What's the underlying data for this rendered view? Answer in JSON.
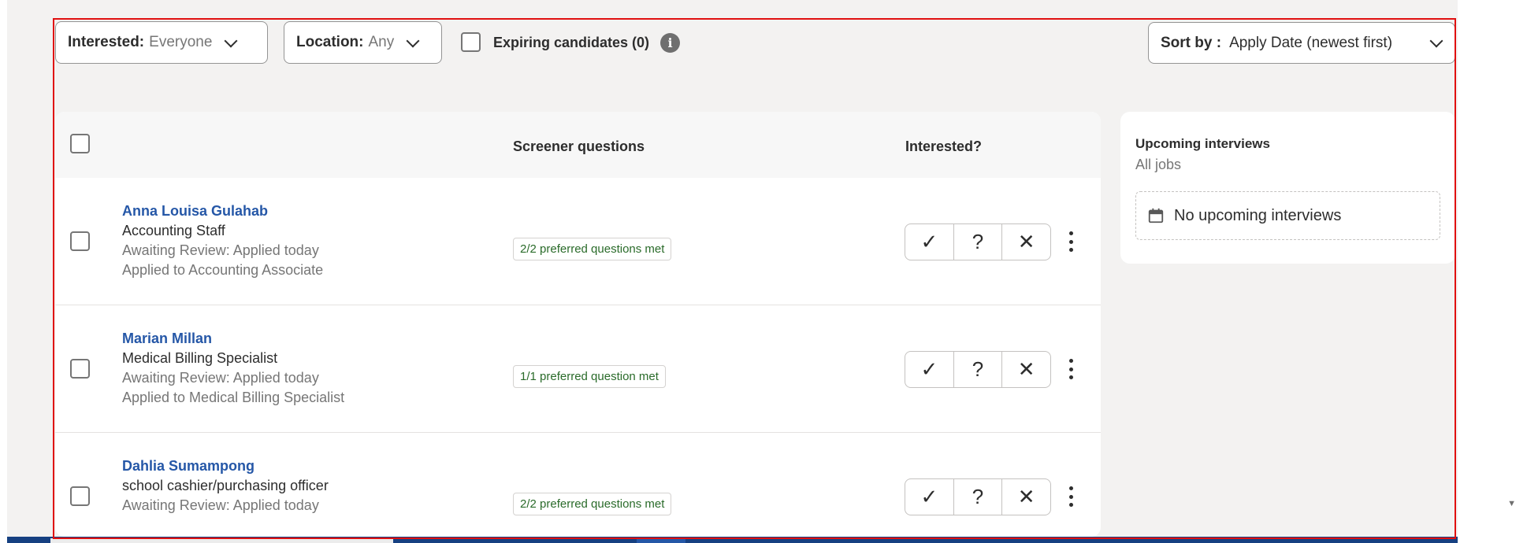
{
  "filters": {
    "interested_key": "Interested:",
    "interested_value": "Everyone",
    "location_key": "Location:",
    "location_value": "Any",
    "expiring_label": "Expiring candidates (0)",
    "info_icon": "i"
  },
  "sort": {
    "key": "Sort by :",
    "value": "Apply Date (newest first)"
  },
  "table": {
    "headers": {
      "screener": "Screener questions",
      "interested": "Interested?"
    },
    "action_icons": {
      "yes": "✓",
      "maybe": "?",
      "no": "✕"
    },
    "candidates": [
      {
        "name": "Anna Louisa Gulahab",
        "job": "Accounting Staff",
        "status": "Awaiting Review: Applied today",
        "applied_to": "Applied to Accounting Associate",
        "screener": "2/2 preferred questions met"
      },
      {
        "name": "Marian Millan",
        "job": "Medical Billing Specialist",
        "status": "Awaiting Review: Applied today",
        "applied_to": "Applied to Medical Billing Specialist",
        "screener": "1/1 preferred question met"
      },
      {
        "name": "Dahlia Sumampong",
        "job": "school cashier/purchasing officer",
        "status": "Awaiting Review: Applied today",
        "applied_to": "",
        "screener": "2/2 preferred questions met"
      }
    ]
  },
  "interviews": {
    "title": "Upcoming interviews",
    "subtitle": "All jobs",
    "empty": "No upcoming interviews"
  },
  "colors": {
    "accent": "#2557a7",
    "screener_text": "#2a6b2a",
    "focus_frame": "#e01010"
  }
}
